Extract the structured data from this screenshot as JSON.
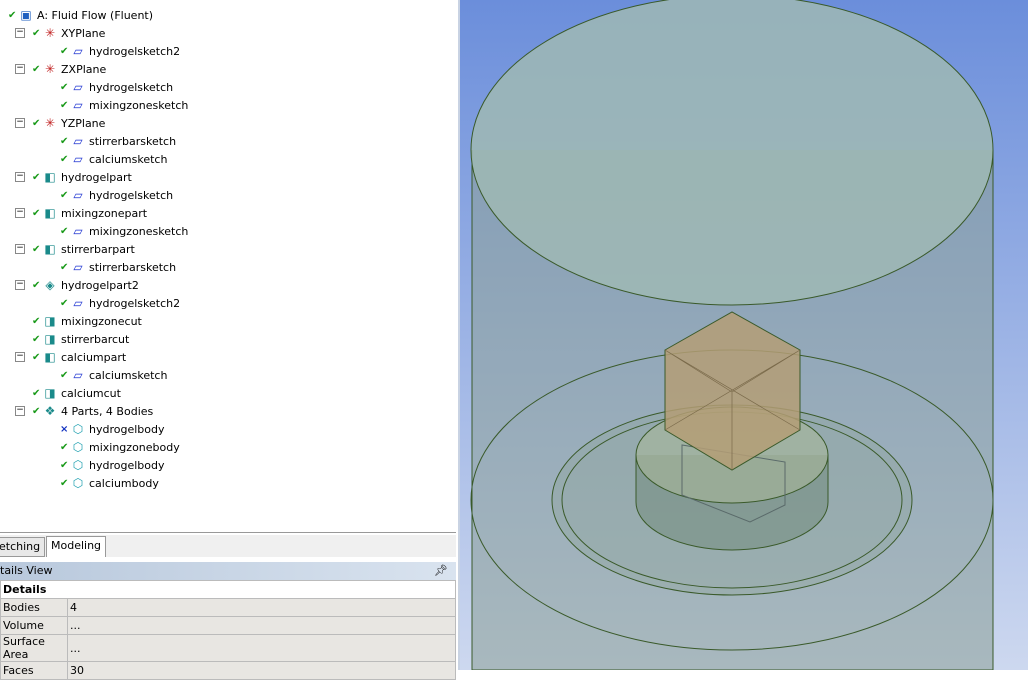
{
  "tree": [
    {
      "level": 0,
      "icon": "model-icon",
      "label": "A: Fluid Flow (Fluent)",
      "status": "check"
    },
    {
      "level": 1,
      "icon": "plane-icon",
      "label": "XYPlane",
      "status": "check"
    },
    {
      "level": 2,
      "icon": "sketch-icon",
      "label": "hydrogelsketch2",
      "status": "check"
    },
    {
      "level": 1,
      "icon": "plane-icon",
      "label": "ZXPlane",
      "status": "check"
    },
    {
      "level": 2,
      "icon": "sketch-icon",
      "label": "hydrogelsketch",
      "status": "check"
    },
    {
      "level": 2,
      "icon": "sketch-icon",
      "label": "mixingzonesketch",
      "status": "check"
    },
    {
      "level": 1,
      "icon": "plane-icon",
      "label": "YZPlane",
      "status": "check"
    },
    {
      "level": 2,
      "icon": "sketch-icon",
      "label": "stirrerbarsketch",
      "status": "check"
    },
    {
      "level": 2,
      "icon": "sketch-icon",
      "label": "calciumsketch",
      "status": "check"
    },
    {
      "level": 1,
      "icon": "extrude-icon",
      "label": "hydrogelpart",
      "status": "check"
    },
    {
      "level": 2,
      "icon": "sketch-icon",
      "label": "hydrogelsketch",
      "status": "check"
    },
    {
      "level": 1,
      "icon": "extrude-icon",
      "label": "mixingzonepart",
      "status": "check"
    },
    {
      "level": 2,
      "icon": "sketch-icon",
      "label": "mixingzonesketch",
      "status": "check"
    },
    {
      "level": 1,
      "icon": "extrude-icon",
      "label": "stirrerbarpart",
      "status": "check"
    },
    {
      "level": 2,
      "icon": "sketch-icon",
      "label": "stirrerbarsketch",
      "status": "check"
    },
    {
      "level": 1,
      "icon": "revolve-icon",
      "label": "hydrogelpart2",
      "status": "check"
    },
    {
      "level": 2,
      "icon": "sketch-icon",
      "label": "hydrogelsketch2",
      "status": "check"
    },
    {
      "level": 1,
      "icon": "cut-icon",
      "label": "mixingzonecut",
      "status": "check"
    },
    {
      "level": 1,
      "icon": "cut-icon",
      "label": "stirrerbarcut",
      "status": "check"
    },
    {
      "level": 1,
      "icon": "extrude-icon",
      "label": "calciumpart",
      "status": "check"
    },
    {
      "level": 2,
      "icon": "sketch-icon",
      "label": "calciumsketch",
      "status": "check"
    },
    {
      "level": 1,
      "icon": "cut-icon",
      "label": "calciumcut",
      "status": "check"
    },
    {
      "level": 1,
      "icon": "parts-icon",
      "label": "4 Parts, 4 Bodies",
      "status": "check"
    },
    {
      "level": 2,
      "icon": "body-icon",
      "label": "hydrogelbody",
      "status": "x"
    },
    {
      "level": 2,
      "icon": "body-icon",
      "label": "mixingzonebody",
      "status": "check"
    },
    {
      "level": 2,
      "icon": "body-icon",
      "label": "hydrogelbody",
      "status": "check"
    },
    {
      "level": 2,
      "icon": "body-icon",
      "label": "calciumbody",
      "status": "check"
    }
  ],
  "tabs": {
    "sketching": "etching",
    "modeling": "Modeling"
  },
  "details": {
    "title": "tails View",
    "section": "Details",
    "rows": [
      [
        "Bodies",
        "4"
      ],
      [
        "Volume",
        "..."
      ],
      [
        "Surface Area",
        "..."
      ],
      [
        "Faces",
        "30"
      ]
    ]
  }
}
